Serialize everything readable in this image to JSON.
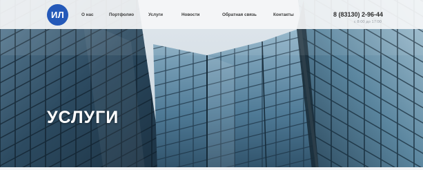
{
  "logo": {
    "text": "ИЛ"
  },
  "nav": [
    {
      "label": "О нас"
    },
    {
      "label": "Портфолио"
    },
    {
      "label": "Услуги"
    },
    {
      "label": "Новости"
    },
    {
      "label": "Обратная связь"
    },
    {
      "label": "Контакты"
    }
  ],
  "contacts": {
    "phone": "8 (83130) 2-96-44",
    "subtext": "с 8:00 до 17:00"
  },
  "hero": {
    "title": "УСЛУГИ"
  },
  "colors": {
    "brand": "#2459b9",
    "header_bg": "#f5f6f8",
    "sky": "#e8edf2",
    "glass_dark": "#1f3b4f",
    "glass_light": "#6f96ad"
  }
}
